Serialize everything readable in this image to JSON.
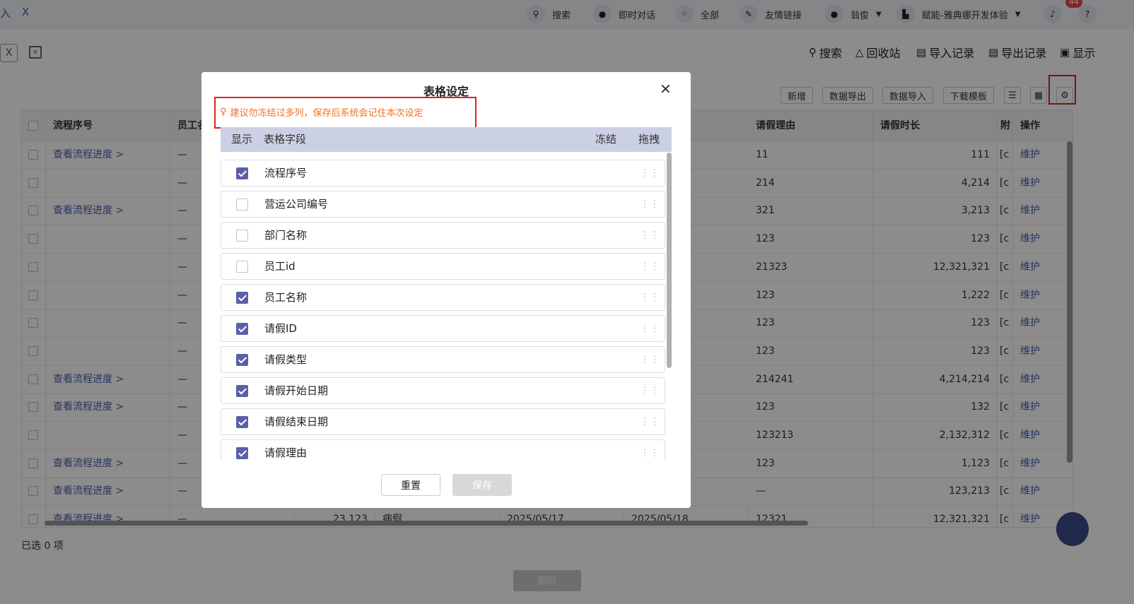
{
  "topbar": {
    "left_text": "入",
    "left_close": "X",
    "items": [
      {
        "label": "搜索",
        "icon": "search-icon"
      },
      {
        "label": "即时对话",
        "icon": "chat-icon"
      },
      {
        "label": "全部",
        "icon": "grid-icon"
      },
      {
        "label": "友情链接",
        "icon": "link-icon"
      },
      {
        "label": "翁俊",
        "icon": "user-icon"
      },
      {
        "label": "赋能-雅典娜开发体验",
        "icon": "building-icon"
      }
    ],
    "notification_count": "44"
  },
  "tools": {
    "search": "搜索",
    "recycle": "回收站",
    "import_log": "导入记录",
    "export_log": "导出记录",
    "display": "显示"
  },
  "buttons": {
    "add": "新增",
    "export": "数据导出",
    "import": "数据导入",
    "template": "下载模板"
  },
  "table": {
    "headers": [
      "流程序号",
      "员工名",
      "请假理由",
      "请假时长",
      "附",
      "操作"
    ],
    "rows": [
      {
        "link": "查看流程进度 >",
        "dash": "—",
        "reason": "11",
        "duration": "111",
        "attach": "[c",
        "action": "维护"
      },
      {
        "link": "",
        "dash": "—",
        "reason": "214",
        "duration": "4,214",
        "attach": "[c",
        "action": "维护"
      },
      {
        "link": "查看流程进度 >",
        "dash": "—",
        "reason": "321",
        "duration": "3,213",
        "attach": "[c",
        "action": "维护"
      },
      {
        "link": "",
        "dash": "—",
        "reason": "123",
        "duration": "123",
        "attach": "[c",
        "action": "维护"
      },
      {
        "link": "",
        "dash": "—",
        "reason": "21323",
        "duration": "12,321,321",
        "attach": "[c",
        "action": "维护"
      },
      {
        "link": "",
        "dash": "—",
        "reason": "123",
        "duration": "1,222",
        "attach": "[c",
        "action": "维护"
      },
      {
        "link": "",
        "dash": "—",
        "reason": "123",
        "duration": "123",
        "attach": "[c",
        "action": "维护"
      },
      {
        "link": "",
        "dash": "—",
        "reason": "123",
        "duration": "123",
        "attach": "[c",
        "action": "维护"
      },
      {
        "link": "查看流程进度 >",
        "dash": "—",
        "reason": "214241",
        "duration": "4,214,214",
        "attach": "[c",
        "action": "维护"
      },
      {
        "link": "查看流程进度 >",
        "dash": "—",
        "reason": "123",
        "duration": "132",
        "attach": "[c",
        "action": "维护"
      },
      {
        "link": "",
        "dash": "—",
        "reason": "123213",
        "duration": "2,132,312",
        "attach": "[c",
        "action": "维护"
      },
      {
        "link": "查看流程进度 >",
        "dash": "—",
        "reason": "123",
        "duration": "1,123",
        "attach": "[c",
        "action": "维护"
      },
      {
        "link": "查看流程进度 >",
        "dash": "—",
        "reason": "—",
        "duration": "123,213",
        "attach": "[c",
        "action": "维护"
      },
      {
        "link": "查看流程进度 >",
        "dash": "—",
        "reason": "12321",
        "duration": "12,321,321",
        "attach": "[c",
        "action": "维护"
      }
    ],
    "last_row_extra": {
      "id": "23,123",
      "type": "病假",
      "start": "2025/05/17",
      "end": "2025/05/18"
    }
  },
  "footer": {
    "selected": "已选 0 项",
    "delete": "删除"
  },
  "modal": {
    "title": "表格设定",
    "tip": "建议勿冻结过多列，保存后系统会记住本次设定",
    "col_show": "显示",
    "col_field": "表格字段",
    "col_freeze": "冻结",
    "col_drag": "拖拽",
    "fields": [
      {
        "label": "流程序号",
        "checked": true
      },
      {
        "label": "营运公司编号",
        "checked": false
      },
      {
        "label": "部门名称",
        "checked": false
      },
      {
        "label": "员工id",
        "checked": false
      },
      {
        "label": "员工名称",
        "checked": true
      },
      {
        "label": "请假ID",
        "checked": true
      },
      {
        "label": "请假类型",
        "checked": true
      },
      {
        "label": "请假开始日期",
        "checked": true
      },
      {
        "label": "请假结束日期",
        "checked": true
      },
      {
        "label": "请假理由",
        "checked": true
      }
    ],
    "reset": "重置",
    "save": "保存"
  }
}
